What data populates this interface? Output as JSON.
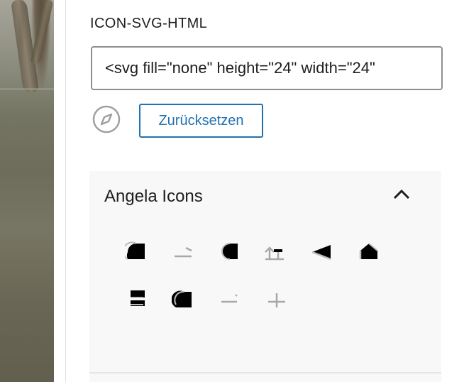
{
  "field": {
    "label": "ICON-SVG-HTML",
    "value": "<svg fill=\"none\" height=\"24\" width=\"24\""
  },
  "actions": {
    "reset_label": "Zurücksetzen"
  },
  "icon_library": {
    "title": "Angela Icons",
    "expanded": true,
    "icons": [
      "partial-half-circle-icon",
      "partial-dash-icon",
      "partial-circle-icon",
      "partial-upload-icon",
      "partial-send-icon",
      "partial-home-icon",
      "partial-hourglass-icon",
      "partial-circle-small-icon",
      "partial-minus-icon",
      "partial-plus-icon"
    ]
  },
  "colors": {
    "accent": "#2271b1",
    "panel_background": "#f8f8f8",
    "text": "#1e1e1e",
    "border": "#8c8f94"
  }
}
